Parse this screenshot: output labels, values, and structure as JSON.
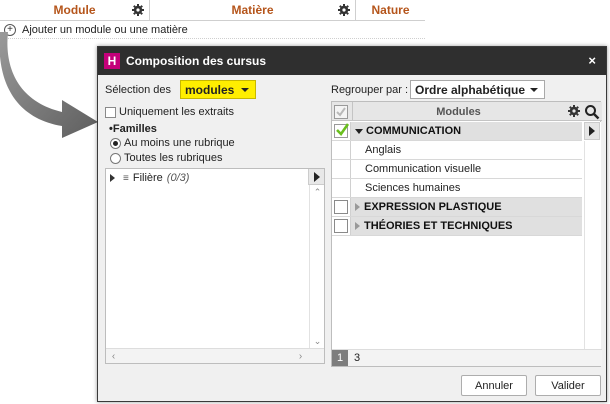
{
  "background": {
    "columns": [
      {
        "label": "Module",
        "width": 150,
        "has_gear": true
      },
      {
        "label": "Matière",
        "width": 206,
        "has_gear": true
      },
      {
        "label": "Nature",
        "width": 69,
        "has_gear": false
      }
    ],
    "add_label": "Ajouter un module ou une matière"
  },
  "dialog": {
    "title": "Composition des cursus",
    "logo": "H",
    "close": "×",
    "selection_label": "Sélection des",
    "selection_value": "modules",
    "group_label": "Regrouper par :",
    "group_value": "Ordre alphabétique",
    "only_extracts_label": "Uniquement les extraits",
    "families_heading": "•Familles",
    "radio_options": [
      {
        "label": "Au moins une rubrique",
        "selected": true
      },
      {
        "label": "Toutes les rubriques",
        "selected": false
      }
    ],
    "tree": [
      {
        "label": "Filière",
        "count": "(0/3)"
      }
    ],
    "modules_header": "Modules",
    "modules": [
      {
        "kind": "group",
        "label": "COMMUNICATION",
        "checked": true,
        "expanded": true
      },
      {
        "kind": "child",
        "label": "Anglais"
      },
      {
        "kind": "child",
        "label": "Communication visuelle"
      },
      {
        "kind": "child",
        "label": "Sciences humaines"
      },
      {
        "kind": "group",
        "label": "EXPRESSION PLASTIQUE",
        "checked": false,
        "expanded": false
      },
      {
        "kind": "group",
        "label": "THÉORIES ET TECHNIQUES",
        "checked": false,
        "expanded": false
      }
    ],
    "pager": {
      "current": "1",
      "total": "3"
    },
    "cancel_label": "Annuler",
    "ok_label": "Valider"
  },
  "colors": {
    "header_text": "#b5551b",
    "title_bar": "#2f2f2f",
    "logo_bg": "#c4007a",
    "selection_bg": "#ffee00",
    "group_row_bg": "#e0e0e0",
    "check_green": "#6abf1e"
  }
}
